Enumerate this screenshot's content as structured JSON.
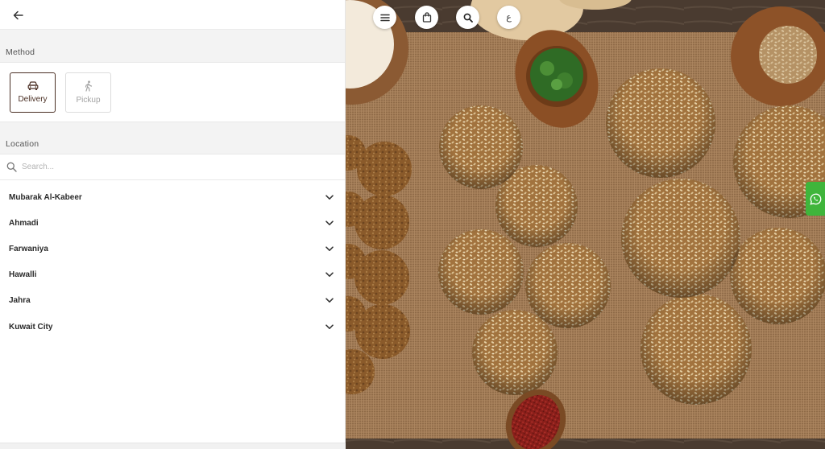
{
  "header": {
    "back_icon": "arrow-left-icon"
  },
  "method": {
    "title": "Method",
    "options": [
      {
        "label": "Delivery",
        "icon": "car-icon",
        "selected": true
      },
      {
        "label": "Pickup",
        "icon": "walking-person-icon",
        "selected": false
      }
    ]
  },
  "location": {
    "title": "Location",
    "search_placeholder": "Search...",
    "search_value": "",
    "areas": [
      {
        "label": "Mubarak Al-Kabeer"
      },
      {
        "label": "Ahmadi"
      },
      {
        "label": "Farwaniya"
      },
      {
        "label": "Hawalli"
      },
      {
        "label": "Jahra"
      },
      {
        "label": "Kuwait City"
      }
    ]
  },
  "hero_nav": {
    "menu_icon": "hamburger-menu-icon",
    "bag_icon": "shopping-bag-icon",
    "search_icon": "search-icon",
    "language_label": "ع"
  },
  "whatsapp": {
    "icon": "whatsapp-icon"
  },
  "colors": {
    "accent": "#4a2f24",
    "whatsapp": "#3fb53b",
    "section_bg": "#f3f3f3"
  }
}
